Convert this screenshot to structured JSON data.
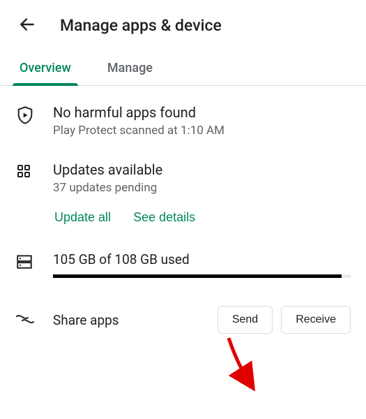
{
  "header": {
    "title": "Manage apps & device"
  },
  "tabs": {
    "overview": "Overview",
    "manage": "Manage"
  },
  "protect": {
    "title": "No harmful apps found",
    "subtitle": "Play Protect scanned at 1:10 AM"
  },
  "updates": {
    "title": "Updates available",
    "subtitle": "37 updates pending",
    "update_all": "Update all",
    "see_details": "See details"
  },
  "storage": {
    "text": "105 GB of 108 GB used",
    "used_gb": 105,
    "total_gb": 108
  },
  "share": {
    "label": "Share apps",
    "send": "Send",
    "receive": "Receive"
  }
}
